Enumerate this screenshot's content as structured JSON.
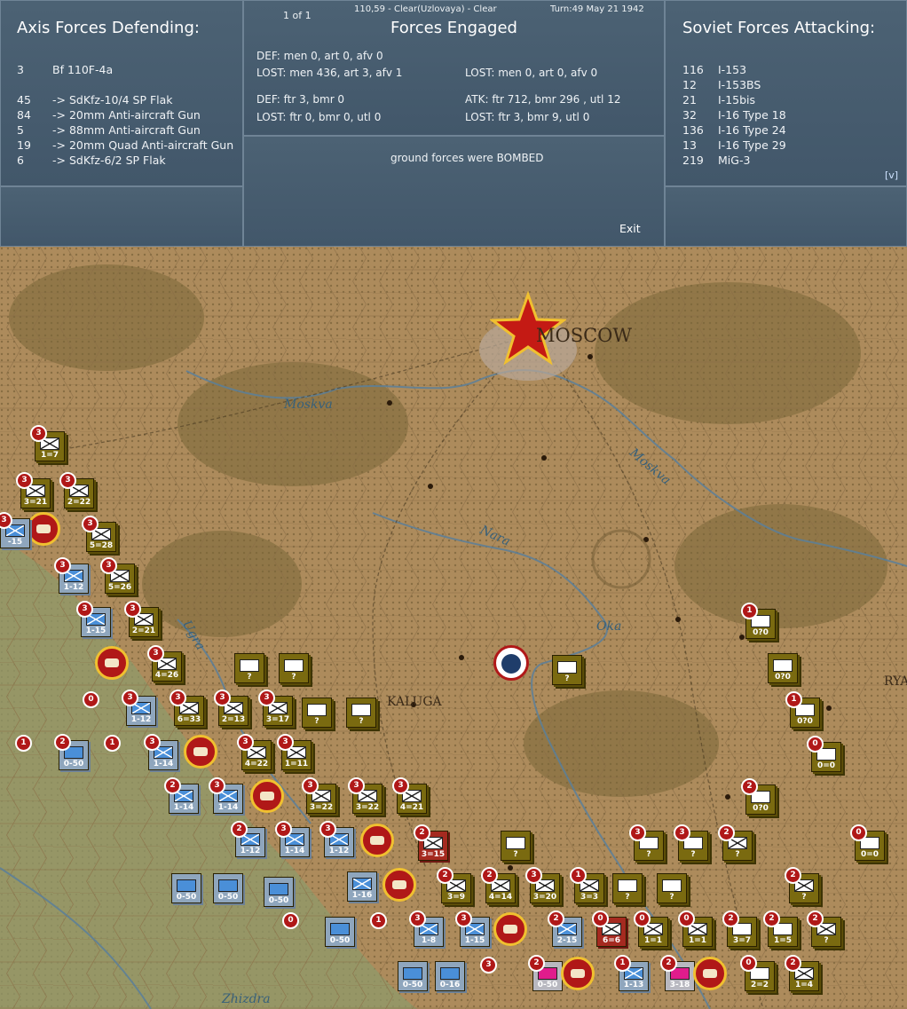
{
  "axis": {
    "title": "Axis Forces Defending:",
    "rows": [
      {
        "n": "3",
        "name": "Bf 110F-4a",
        "gap": true
      },
      {
        "n": "45",
        "name": "-> SdKfz-10/4 SP Flak"
      },
      {
        "n": "84",
        "name": "-> 20mm Anti-aircraft Gun"
      },
      {
        "n": "5",
        "name": "-> 88mm Anti-aircraft Gun"
      },
      {
        "n": "19",
        "name": "-> 20mm Quad Anti-aircraft Gun"
      },
      {
        "n": "6",
        "name": "-> SdKfz-6/2 SP Flak"
      }
    ]
  },
  "engaged": {
    "page": "1 of 1",
    "location": "110,59 - Clear(Uzlovaya) - Clear",
    "turn": "Turn:49  May 21 1942",
    "title": "Forces Engaged",
    "def_ground": "DEF: men 0, art 0, afv 0",
    "lost_def_ground": "LOST: men 436, art 3, afv 1",
    "lost_att_ground": "LOST: men 0, art 0, afv 0",
    "def_air": "DEF: ftr 3, bmr 0",
    "atk_air": "ATK: ftr 712, bmr 296 , utl 12",
    "lost_def_air": "LOST: ftr 0, bmr 0, utl 0",
    "lost_atk_air": "LOST: ftr 3, bmr 9, utl 0",
    "result": "ground forces were BOMBED",
    "exit": "Exit"
  },
  "soviet": {
    "title": "Soviet Forces Attacking:",
    "rows": [
      {
        "n": "116",
        "name": "I-153"
      },
      {
        "n": "12",
        "name": "I-153BS"
      },
      {
        "n": "21",
        "name": "I-15bis"
      },
      {
        "n": "32",
        "name": "I-16 Type 18"
      },
      {
        "n": "136",
        "name": "I-16 Type 24"
      },
      {
        "n": "13",
        "name": "I-16 Type 29"
      },
      {
        "n": "219",
        "name": "MiG-3"
      }
    ],
    "toggle": "[v]"
  },
  "map": {
    "labels": {
      "moscow": "MOSCOW",
      "kaluga": "KALUGA",
      "rya": "RYA"
    },
    "rivers": {
      "moskva1": "Moskva",
      "moskva2": "Moskva",
      "nara": "Nara",
      "oka": "Oka",
      "ugra": "Ugra",
      "zhizdra": "Zhizdra"
    },
    "colors": {
      "terrain": "#a8875a",
      "forest": "#7f6a3c",
      "hexline": "#8c7048",
      "river": "#5b7f9a",
      "panel": "#44596b"
    }
  }
}
